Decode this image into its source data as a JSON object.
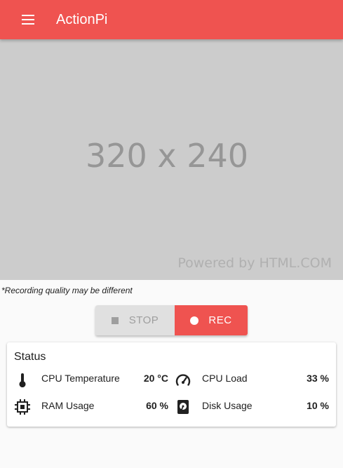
{
  "appbar": {
    "title": "ActionPi",
    "menu_icon": "hamburger-menu-icon"
  },
  "preview": {
    "size_text": "320 x 240",
    "powered_text": "Powered by HTML.COM"
  },
  "note": "*Recording quality may be different",
  "controls": {
    "stop_label": "STOP",
    "rec_label": "REC",
    "stop_icon": "stop-square-icon",
    "rec_icon": "record-dot-icon"
  },
  "status": {
    "title": "Status",
    "items": [
      {
        "label": "CPU Temperature",
        "value": "20 °C",
        "icon": "thermometer-icon"
      },
      {
        "label": "CPU Load",
        "value": "33 %",
        "icon": "speedometer-icon"
      },
      {
        "label": "RAM Usage",
        "value": "60 %",
        "icon": "memory-chip-icon"
      },
      {
        "label": "Disk Usage",
        "value": "10 %",
        "icon": "hard-disk-icon"
      }
    ]
  },
  "colors": {
    "accent": "#ef5350",
    "preview_bg": "#cccccc",
    "stop_bg": "#e0e0e0"
  }
}
